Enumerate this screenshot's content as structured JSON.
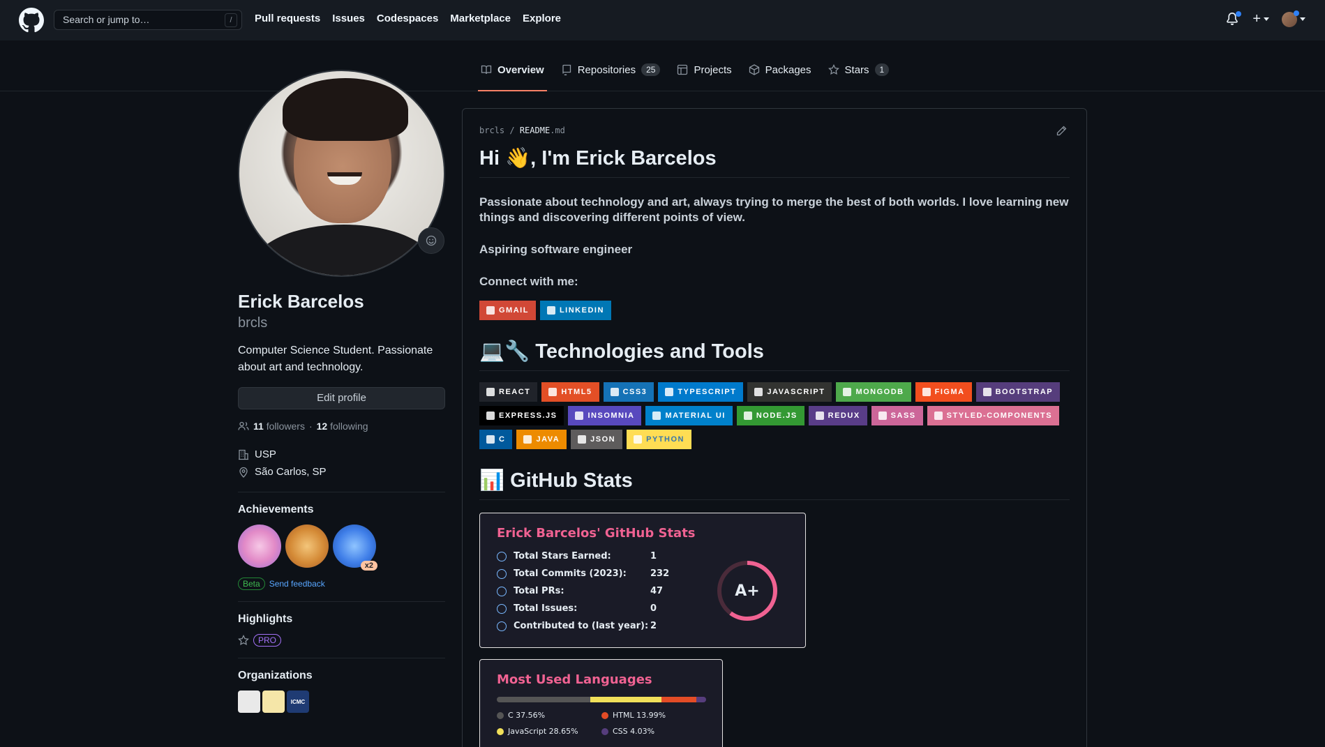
{
  "topbar": {
    "search_placeholder": "Search or jump to…",
    "search_shortcut": "/",
    "nav": [
      "Pull requests",
      "Issues",
      "Codespaces",
      "Marketplace",
      "Explore"
    ],
    "plus_label": "+"
  },
  "tabs": [
    {
      "label": "Overview",
      "icon": "book-icon"
    },
    {
      "label": "Repositories",
      "icon": "repo-icon",
      "count": "25"
    },
    {
      "label": "Projects",
      "icon": "table-icon"
    },
    {
      "label": "Packages",
      "icon": "package-icon"
    },
    {
      "label": "Stars",
      "icon": "star-icon",
      "count": "1"
    }
  ],
  "profile": {
    "name": "Erick Barcelos",
    "login": "brcls",
    "bio": "Computer Science Student. Passionate about art and technology.",
    "edit_label": "Edit profile",
    "followers_count": "11",
    "followers_label": "followers",
    "separator": "·",
    "following_count": "12",
    "following_label": "following",
    "org": "USP",
    "location": "São Carlos, SP"
  },
  "sidebar": {
    "achievements_title": "Achievements",
    "achievement_multiplier": "x2",
    "beta_label": "Beta",
    "feedback_label": "Send feedback",
    "highlights_title": "Highlights",
    "pro_label": "PRO",
    "organizations_title": "Organizations",
    "org3_text": "ICMC"
  },
  "readme": {
    "owner": "brcls",
    "slash": "/",
    "file_base": "README",
    "file_ext": ".md",
    "title": "Hi 👋, I'm Erick Barcelos",
    "intro": "Passionate about technology and art, always trying to merge the best of both worlds. I love learning new things and discovering different points of view.",
    "aspiring": "Aspiring software engineer",
    "connect": "Connect with me:",
    "connect_badges": [
      {
        "label": "GMAIL",
        "color": "#D14836"
      },
      {
        "label": "LINKEDIN",
        "color": "#0077B5"
      }
    ],
    "tech_title": "💻🔧 Technologies and Tools",
    "tech_badges": [
      {
        "label": "REACT",
        "color": "#20232a"
      },
      {
        "label": "HTML5",
        "color": "#E34F26"
      },
      {
        "label": "CSS3",
        "color": "#1572B6"
      },
      {
        "label": "TYPESCRIPT",
        "color": "#007ACC"
      },
      {
        "label": "JAVASCRIPT",
        "color": "#323330"
      },
      {
        "label": "MONGODB",
        "color": "#4ea94b"
      },
      {
        "label": "FIGMA",
        "color": "#F24E1E"
      },
      {
        "label": "BOOTSTRAP",
        "color": "#563D7C"
      },
      {
        "label": "EXPRESS.JS",
        "color": "#000000"
      },
      {
        "label": "INSOMNIA",
        "color": "#5849be"
      },
      {
        "label": "MATERIAL UI",
        "color": "#0081CB"
      },
      {
        "label": "NODE.JS",
        "color": "#339933"
      },
      {
        "label": "REDUX",
        "color": "#593d88"
      },
      {
        "label": "SASS",
        "color": "#CC6699"
      },
      {
        "label": "STYLED-COMPONENTS",
        "color": "#DB7093"
      },
      {
        "label": "C",
        "color": "#00599C"
      },
      {
        "label": "JAVA",
        "color": "#ED8B00"
      },
      {
        "label": "JSON",
        "color": "#5E5C5C"
      },
      {
        "label": "PYTHON",
        "color": "#ffdd54"
      }
    ],
    "stats_title": "📊 GitHub Stats"
  },
  "stats_card": {
    "title": "Erick Barcelos' GitHub Stats",
    "rows": [
      {
        "label": "Total Stars Earned:",
        "value": "1"
      },
      {
        "label": "Total Commits (2023):",
        "value": "232"
      },
      {
        "label": "Total PRs:",
        "value": "47"
      },
      {
        "label": "Total Issues:",
        "value": "0"
      },
      {
        "label": "Contributed to (last year):",
        "value": "2"
      }
    ],
    "grade": "A+"
  },
  "lang_card": {
    "title": "Most Used Languages",
    "languages": [
      {
        "name": "C",
        "percent": 37.56,
        "label": "C 37.56%",
        "color": "#555555"
      },
      {
        "name": "JavaScript",
        "percent": 28.65,
        "label": "JavaScript 28.65%",
        "color": "#f1e05a"
      },
      {
        "name": "HTML",
        "percent": 13.99,
        "label": "HTML 13.99%",
        "color": "#e34c26"
      },
      {
        "name": "CSS",
        "percent": 4.03,
        "label": "CSS 4.03%",
        "color": "#563d7c"
      }
    ]
  }
}
